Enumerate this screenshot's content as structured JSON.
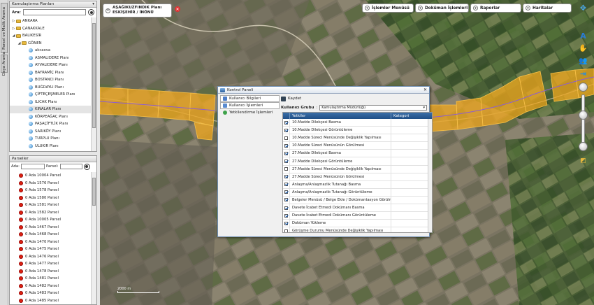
{
  "vertical_tabs": [
    "Parsel ve Malik Arama",
    "Daya Arama"
  ],
  "plan_tree": {
    "title": "Kamulaştırma Planları",
    "search_label": "Ara:",
    "nodes": [
      {
        "label": "ANKARA",
        "type": "folder",
        "level": 1
      },
      {
        "label": "ÇANAKKALE",
        "type": "folder",
        "level": 1
      },
      {
        "label": "BALIKESİR",
        "type": "folder",
        "level": 1
      },
      {
        "label": "GÖNEN",
        "type": "folder",
        "level": 2
      },
      {
        "label": "akcaova",
        "type": "plan",
        "level": 3
      },
      {
        "label": "ASMALIDERE Planı",
        "type": "plan",
        "level": 3
      },
      {
        "label": "AYVALIDERE Planı",
        "type": "plan",
        "level": 3
      },
      {
        "label": "BAYRAMİÇ Planı",
        "type": "plan",
        "level": 3
      },
      {
        "label": "BOSTANCI Planı",
        "type": "plan",
        "level": 3
      },
      {
        "label": "BUĞDAYLI Planı",
        "type": "plan",
        "level": 3
      },
      {
        "label": "ÇİFTEÇEŞMELER Planı",
        "type": "plan",
        "level": 3
      },
      {
        "label": "ILICAK Planı",
        "type": "plan",
        "level": 3
      },
      {
        "label": "KINALAR Planı",
        "type": "plan",
        "level": 3,
        "selected": true
      },
      {
        "label": "KÖRPEAĞAÇ Planı",
        "type": "plan",
        "level": 3
      },
      {
        "label": "PAŞAÇİFTLİK Planı",
        "type": "plan",
        "level": 3
      },
      {
        "label": "SARIKÖY Planı",
        "type": "plan",
        "level": 3
      },
      {
        "label": "TURPLU Planı",
        "type": "plan",
        "level": 3
      },
      {
        "label": "ULUKIR Planı",
        "type": "plan",
        "level": 3
      }
    ]
  },
  "parcels": {
    "title": "Parseller",
    "ada_label": "Ada:",
    "parsel_label": "Parsel:",
    "items": [
      "0 Ada 10004 Parsel",
      "0 Ada 1576 Parsel",
      "0 Ada 1578 Parsel",
      "0 Ada 1580 Parsel",
      "0 Ada 1581 Parsel",
      "0 Ada 1582 Parsel",
      "0 Ada 10005 Parsel",
      "0 Ada 1467 Parsel",
      "0 Ada 1468 Parsel",
      "0 Ada 1470 Parsel",
      "0 Ada 1475 Parsel",
      "0 Ada 1476 Parsel",
      "0 Ada 1477 Parsel",
      "0 Ada 1478 Parsel",
      "0 Ada 1481 Parsel",
      "0 Ada 1482 Parsel",
      "0 Ada 1483 Parsel",
      "0 Ada 1485 Parsel"
    ]
  },
  "active_plan": {
    "line1": "AŞAĞIKUZFINDIK Planı",
    "line2": "ESKİŞEHİR / İNÖNÜ"
  },
  "menus": [
    "İşlemler Menüsü",
    "Doküman İşlemleri",
    "Raporlar",
    "Haritalar"
  ],
  "tools": [
    {
      "icon": "compass-rose-icon",
      "glyph": "✥"
    },
    {
      "icon": "text-tool-icon",
      "glyph": "A"
    },
    {
      "icon": "pan-hand-icon",
      "glyph": "✋"
    },
    {
      "icon": "users-icon",
      "glyph": "👥"
    },
    {
      "icon": "exit-icon",
      "glyph": "⇥"
    }
  ],
  "scale": {
    "label": "2000 m"
  },
  "dialog": {
    "title": "Kontrol Paneli",
    "nav": [
      "Kullanıcı Bilgileri",
      "Kullanıcı İşlemleri",
      "Yetkilendirme İşlemleri"
    ],
    "save_label": "Kaydet",
    "group_label": "Kullanıcı Grubu",
    "group_value": "Kamulaştırma Müdürlüğü",
    "col_perm": "Yetkiler",
    "col_cat": "Kategori",
    "rows": [
      {
        "label": "10.Madde Dilekçesi Basma",
        "checked": true
      },
      {
        "label": "10.Madde Dilekçesi Görüntüleme",
        "checked": true
      },
      {
        "label": "10.Madde Süreci Menüsünde Değişiklik Yapılması",
        "checked": false
      },
      {
        "label": "10.Madde Süreci Menüsünün Görülmesi",
        "checked": true
      },
      {
        "label": "27.Madde Dilekçesi Basma",
        "checked": true
      },
      {
        "label": "27.Madde Dilekçesi Görüntüleme",
        "checked": true
      },
      {
        "label": "27.Madde Süreci Menüsünde Değişiklik Yapılması",
        "checked": false
      },
      {
        "label": "27.Madde Süreci Menüsünün Görülmesi",
        "checked": true
      },
      {
        "label": "Anlaşma/Anlaşmazlık Tutanağı Basma",
        "checked": true
      },
      {
        "label": "Anlaşma/Anlaşmazlık Tutanağı Görüntüleme",
        "checked": true
      },
      {
        "label": "Belgeler Menüsü / Belge Ekle / Dokümantasyon Görülme",
        "checked": true
      },
      {
        "label": "Davete İcabet Etmedi Dokümanı Basma",
        "checked": true
      },
      {
        "label": "Davete İcabet Etmedi Dokümanı Görüntüleme",
        "checked": true
      },
      {
        "label": "Doküman Yükleme",
        "checked": true
      },
      {
        "label": "Görüşme Durumu Menüsünde Değişiklik Yapılması",
        "checked": false
      }
    ]
  },
  "colors": {
    "parcel_fill": "#f2a81d",
    "route_line": "#8a5cd6",
    "grid_header": "#2a5c96"
  }
}
